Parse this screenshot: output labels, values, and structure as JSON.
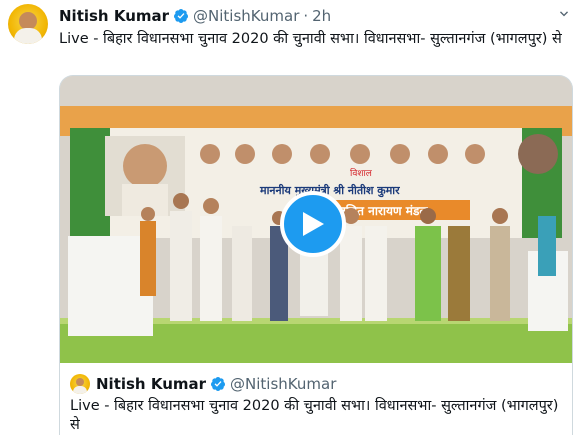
{
  "tweet": {
    "author_name": "Nitish Kumar",
    "handle": "@NitishKumar",
    "separator": "·",
    "time": "2h",
    "text": "Live - बिहार विधानसभा चुनाव 2020 की चुनावी सभा। विधानसभा- सुल्तानगंज (भागलपुर) से",
    "icons": {
      "verified": "verified-badge-icon",
      "more": "chevron-down-icon",
      "play": "play-icon"
    }
  },
  "quote": {
    "author_name": "Nitish Kumar",
    "handle": "@NitishKumar",
    "text": "Live - बिहार विधानसभा चुनाव 2020 की चुनावी सभा। विधानसभा- सुल्तानगंज (भागलपुर) से"
  },
  "banner": {
    "line1": "विशाल",
    "line2": "माननीय मुख्यमंत्री श्री नीतीश कुमार",
    "line3": "श्री ललित नारायण मंडल"
  },
  "colors": {
    "accent": "#1d9bf0",
    "banner_green": "#3f8f3a",
    "banner_orange": "#e98a2a"
  }
}
